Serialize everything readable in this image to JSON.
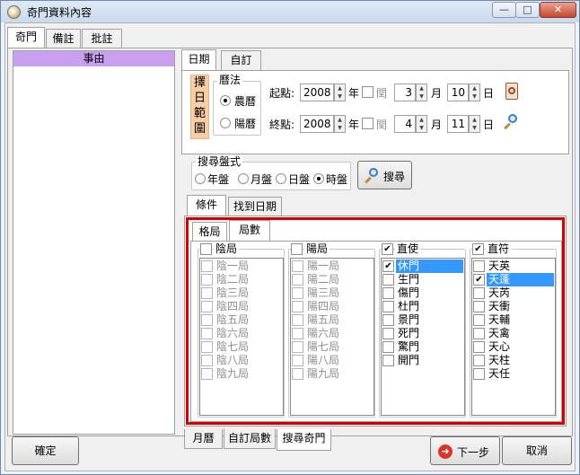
{
  "window": {
    "title": "奇門資料內容",
    "minimize": "—",
    "maximize": "□",
    "close": "✕"
  },
  "main_tabs": [
    "奇門",
    "備註",
    "批註"
  ],
  "left_panel": {
    "header": "事由"
  },
  "date_tabs": [
    "日期",
    "自訂"
  ],
  "range": {
    "label_chars": [
      "擇",
      "日",
      "範",
      "圍"
    ],
    "calendar": {
      "title": "曆法",
      "options": [
        "農曆",
        "陽曆"
      ],
      "selected": "農曆"
    },
    "start": {
      "label": "起點:",
      "year": "2008",
      "year_unit": "年",
      "leap_label": "閏",
      "month": "3",
      "month_unit": "月",
      "day": "10",
      "day_unit": "日"
    },
    "end": {
      "label": "終點:",
      "year": "2008",
      "year_unit": "年",
      "leap_label": "閏",
      "month": "4",
      "month_unit": "月",
      "day": "11",
      "day_unit": "日"
    }
  },
  "search_type": {
    "title": "搜尋盤式",
    "options": [
      "年盤",
      "月盤",
      "日盤",
      "時盤"
    ],
    "selected": "時盤"
  },
  "search_button": "搜尋",
  "condition_tabs": [
    "條件",
    "找到日期"
  ],
  "sub_tabs": [
    "格局",
    "局數"
  ],
  "lists": [
    {
      "header": "陰局",
      "header_checked": false,
      "enabled": false,
      "items": [
        {
          "label": "陰一局",
          "checked": false
        },
        {
          "label": "陰二局",
          "checked": false
        },
        {
          "label": "陰三局",
          "checked": false
        },
        {
          "label": "陰四局",
          "checked": false
        },
        {
          "label": "陰五局",
          "checked": false
        },
        {
          "label": "陰六局",
          "checked": false
        },
        {
          "label": "陰七局",
          "checked": false
        },
        {
          "label": "陰八局",
          "checked": false
        },
        {
          "label": "陰九局",
          "checked": false
        }
      ]
    },
    {
      "header": "陽局",
      "header_checked": false,
      "enabled": false,
      "items": [
        {
          "label": "陽一局",
          "checked": false
        },
        {
          "label": "陽二局",
          "checked": false
        },
        {
          "label": "陽三局",
          "checked": false
        },
        {
          "label": "陽四局",
          "checked": false
        },
        {
          "label": "陽五局",
          "checked": false
        },
        {
          "label": "陽六局",
          "checked": false
        },
        {
          "label": "陽七局",
          "checked": false
        },
        {
          "label": "陽八局",
          "checked": false
        },
        {
          "label": "陽九局",
          "checked": false
        }
      ]
    },
    {
      "header": "直使",
      "header_checked": true,
      "enabled": true,
      "items": [
        {
          "label": "休門",
          "checked": true,
          "selected": true
        },
        {
          "label": "生門",
          "checked": false
        },
        {
          "label": "傷門",
          "checked": false
        },
        {
          "label": "杜門",
          "checked": false
        },
        {
          "label": "景門",
          "checked": false
        },
        {
          "label": "死門",
          "checked": false
        },
        {
          "label": "驚門",
          "checked": false
        },
        {
          "label": "開門",
          "checked": false
        }
      ]
    },
    {
      "header": "直符",
      "header_checked": true,
      "enabled": true,
      "items": [
        {
          "label": "天英",
          "checked": false
        },
        {
          "label": "天蓬",
          "checked": true,
          "selected": true
        },
        {
          "label": "天芮",
          "checked": false
        },
        {
          "label": "天衝",
          "checked": false
        },
        {
          "label": "天輔",
          "checked": false
        },
        {
          "label": "天禽",
          "checked": false
        },
        {
          "label": "天心",
          "checked": false
        },
        {
          "label": "天柱",
          "checked": false
        },
        {
          "label": "天任",
          "checked": false
        }
      ]
    }
  ],
  "bottom_tabs": [
    "月曆",
    "自訂局數",
    "搜尋奇門"
  ],
  "footer": {
    "ok": "確定",
    "next": "下一步",
    "cancel": "取消"
  },
  "colors": {
    "highlight_border": "#d40000",
    "selection": "#3399ff",
    "list_header": "#c9a0f0",
    "range_label_bg": "#f7cda4"
  }
}
